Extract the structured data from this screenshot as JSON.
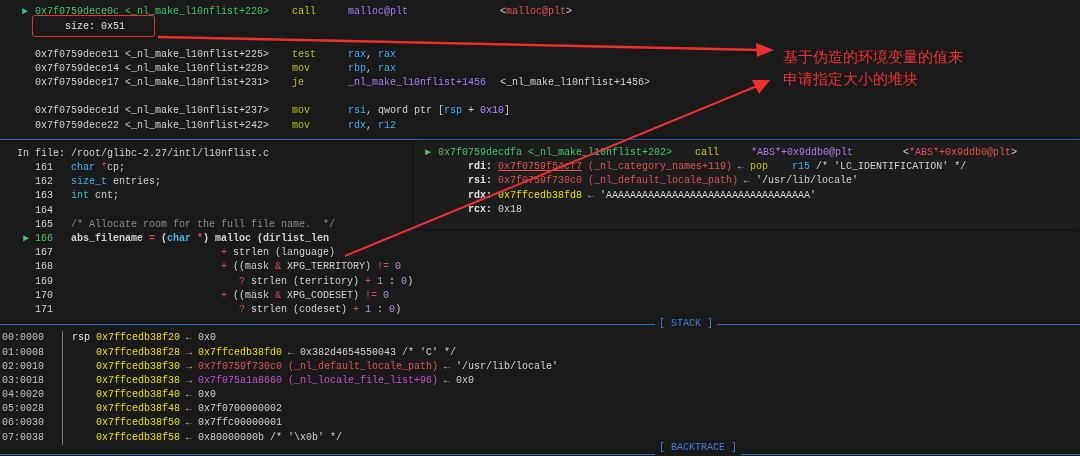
{
  "disassembly": {
    "lines": [
      {
        "kind": "instruction",
        "current": true,
        "marker": "►",
        "address": "0x7f0759dece0c <_nl_make_l10nflist+220>",
        "mnemonic": "call",
        "operands": [
          {
            "text": "malloc@plt",
            "kind": "func"
          }
        ],
        "target": [
          {
            "text": "<",
            "kind": "plain"
          },
          {
            "text": "malloc@plt",
            "kind": "red"
          },
          {
            "text": ">",
            "kind": "plain"
          }
        ]
      },
      {
        "kind": "annotation",
        "text": "size: 0x51",
        "highlighted": true
      },
      {
        "kind": "blank"
      },
      {
        "kind": "instruction",
        "current": false,
        "address": "0x7f0759dece11 <_nl_make_l10nflist+225>",
        "mnemonic": "test",
        "operands": [
          {
            "text": "rax",
            "kind": "reg"
          },
          {
            "text": ", ",
            "kind": "plain"
          },
          {
            "text": "rax",
            "kind": "reg"
          }
        ]
      },
      {
        "kind": "instruction",
        "current": false,
        "address": "0x7f0759dece14 <_nl_make_l10nflist+228>",
        "mnemonic": "mov",
        "operands": [
          {
            "text": "rbp",
            "kind": "reg"
          },
          {
            "text": ", ",
            "kind": "plain"
          },
          {
            "text": "rax",
            "kind": "reg"
          }
        ]
      },
      {
        "kind": "instruction",
        "current": false,
        "address": "0x7f0759dece17 <_nl_make_l10nflist+231>",
        "mnemonic": "je",
        "operands": [
          {
            "text": "_nl_make_l10nflist+1456",
            "kind": "func"
          }
        ],
        "target": [
          {
            "text": "<_nl_make_l10nflist+1456>",
            "kind": "plain"
          }
        ]
      },
      {
        "kind": "blank"
      },
      {
        "kind": "instruction",
        "current": false,
        "address": "0x7f0759dece1d <_nl_make_l10nflist+237>",
        "mnemonic": "mov",
        "operands": [
          {
            "text": "rsi",
            "kind": "reg"
          },
          {
            "text": ", qword ptr [",
            "kind": "plain"
          },
          {
            "text": "rsp",
            "kind": "reg"
          },
          {
            "text": " + ",
            "kind": "plain"
          },
          {
            "text": "0x10",
            "kind": "num"
          },
          {
            "text": "]",
            "kind": "plain"
          }
        ]
      },
      {
        "kind": "instruction",
        "current": false,
        "address": "0x7f0759dece22 <_nl_make_l10nflist+242>",
        "mnemonic": "mov",
        "operands": [
          {
            "text": "rdx",
            "kind": "reg"
          },
          {
            "text": ", ",
            "kind": "plain"
          },
          {
            "text": "r12",
            "kind": "reg"
          }
        ]
      }
    ]
  },
  "source": {
    "file_label": "In file:",
    "path": "/root/glibc-2.27/intl/l10nflist.c",
    "lines": [
      {
        "number": "161",
        "current": false,
        "code": [
          {
            "text": "char",
            "kind": "kw"
          },
          {
            "text": " *",
            "kind": "op"
          },
          {
            "text": "cp;",
            "kind": "plain"
          }
        ]
      },
      {
        "number": "162",
        "current": false,
        "code": [
          {
            "text": "size_t",
            "kind": "kw"
          },
          {
            "text": " entries;",
            "kind": "plain"
          }
        ]
      },
      {
        "number": "163",
        "current": false,
        "code": [
          {
            "text": "int",
            "kind": "kw"
          },
          {
            "text": " cnt;",
            "kind": "plain"
          }
        ]
      },
      {
        "number": "164",
        "current": false
      },
      {
        "number": "165",
        "current": false,
        "code": [
          {
            "text": "/* Allocate room for the full file name.  */",
            "kind": "comment"
          }
        ]
      },
      {
        "number": "166",
        "current": true,
        "marker": "►",
        "code": [
          {
            "text": "abs_filename ",
            "kind": "plain"
          },
          {
            "text": "=",
            "kind": "op"
          },
          {
            "text": " (",
            "kind": "plain"
          },
          {
            "text": "char",
            "kind": "kw"
          },
          {
            "text": " *",
            "kind": "op"
          },
          {
            "text": ") malloc (dirlist_len",
            "kind": "plain"
          }
        ]
      },
      {
        "number": "167",
        "current": false,
        "code": [
          {
            "text": "                         +",
            "kind": "op"
          },
          {
            "text": " strlen (language)",
            "kind": "plain"
          }
        ]
      },
      {
        "number": "168",
        "current": false,
        "code": [
          {
            "text": "                         +",
            "kind": "op"
          },
          {
            "text": " ((mask ",
            "kind": "plain"
          },
          {
            "text": "&",
            "kind": "op"
          },
          {
            "text": " XPG_TERRITORY) ",
            "kind": "plain"
          },
          {
            "text": "!=",
            "kind": "op"
          },
          {
            "text": " 0",
            "kind": "num"
          }
        ]
      },
      {
        "number": "169",
        "current": false,
        "code": [
          {
            "text": "                            ?",
            "kind": "op"
          },
          {
            "text": " strlen (territory) ",
            "kind": "plain"
          },
          {
            "text": "+",
            "kind": "op"
          },
          {
            "text": " 1",
            "kind": "num"
          },
          {
            "text": " : ",
            "kind": "plain"
          },
          {
            "text": "0",
            "kind": "num"
          },
          {
            "text": ")",
            "kind": "plain"
          }
        ]
      },
      {
        "number": "170",
        "current": false,
        "code": [
          {
            "text": "                         +",
            "kind": "op"
          },
          {
            "text": " ((mask ",
            "kind": "plain"
          },
          {
            "text": "&",
            "kind": "op"
          },
          {
            "text": " XPG_CODESET) ",
            "kind": "plain"
          },
          {
            "text": "!=",
            "kind": "op"
          },
          {
            "text": " 0",
            "kind": "num"
          }
        ]
      },
      {
        "number": "171",
        "current": false,
        "code": [
          {
            "text": "                            ?",
            "kind": "op"
          },
          {
            "text": " strlen (codeset) ",
            "kind": "plain"
          },
          {
            "text": "+",
            "kind": "op"
          },
          {
            "text": " 1",
            "kind": "num"
          },
          {
            "text": " : ",
            "kind": "plain"
          },
          {
            "text": "0",
            "kind": "num"
          },
          {
            "text": ")",
            "kind": "plain"
          }
        ]
      }
    ]
  },
  "stack": {
    "title": "[ STACK ]",
    "rows": [
      {
        "offset": "00:0000",
        "register": "rsp",
        "chain": [
          {
            "text": "0x7ffcedb38f20",
            "kind": "yellow"
          },
          {
            "text": " ← 0x0",
            "kind": "plain"
          }
        ]
      },
      {
        "offset": "01:0008",
        "chain": [
          {
            "text": "0x7ffcedb38f28",
            "kind": "yellow"
          },
          {
            "text": " → ",
            "kind": "plain"
          },
          {
            "text": "0x7ffcedb38fd0",
            "kind": "yellow"
          },
          {
            "text": " ← 0x382d4654550043 /* 'C' */",
            "kind": "plain"
          }
        ]
      },
      {
        "offset": "02:0010",
        "chain": [
          {
            "text": "0x7ffcedb38f30",
            "kind": "yellow"
          },
          {
            "text": " → ",
            "kind": "plain"
          },
          {
            "text": "0x7f0759f730c0 (_nl_default_locale_path)",
            "kind": "red"
          },
          {
            "text": " ← '/usr/lib/locale'",
            "kind": "plain"
          }
        ]
      },
      {
        "offset": "03:0018",
        "chain": [
          {
            "text": "0x7ffcedb38f38",
            "kind": "yellow"
          },
          {
            "text": " → ",
            "kind": "plain"
          },
          {
            "text": "0x7f075a1a8660 (_nl_locale_file_list+96)",
            "kind": "magenta"
          },
          {
            "text": " ← 0x0",
            "kind": "plain"
          }
        ]
      },
      {
        "offset": "04:0020",
        "chain": [
          {
            "text": "0x7ffcedb38f40",
            "kind": "yellow"
          },
          {
            "text": " ← 0x0",
            "kind": "plain"
          }
        ]
      },
      {
        "offset": "05:0028",
        "chain": [
          {
            "text": "0x7ffcedb38f48",
            "kind": "yellow"
          },
          {
            "text": " ← 0x7f0700000002",
            "kind": "plain"
          }
        ]
      },
      {
        "offset": "06:0030",
        "chain": [
          {
            "text": "0x7ffcedb38f50",
            "kind": "yellow"
          },
          {
            "text": " ← 0x7ffc00000001",
            "kind": "plain"
          }
        ]
      },
      {
        "offset": "07:0038",
        "chain": [
          {
            "text": "0x7ffcedb38f58",
            "kind": "yellow"
          },
          {
            "text": " ← 0x80000000b /* '\\x0b' */",
            "kind": "plain"
          }
        ]
      }
    ]
  },
  "backtrace": {
    "title": "[ BACKTRACE ]"
  },
  "inset": {
    "lines": [
      {
        "kind": "instruction",
        "current": true,
        "marker": "►",
        "address": "0x7f0759decdfa <_nl_make_l10nflist+202>",
        "mnemonic": "call",
        "operands": [
          {
            "text": "*ABS*+0x9ddb0@plt",
            "kind": "func"
          }
        ],
        "target": [
          {
            "text": "<",
            "kind": "plain"
          },
          {
            "text": "*ABS*+0x9ddb0@plt",
            "kind": "red"
          },
          {
            "text": ">",
            "kind": "plain"
          }
        ]
      },
      {
        "kind": "argument",
        "register": "rdi:",
        "value": [
          {
            "text": "0x7f0759f54cf7",
            "kind": "link"
          },
          {
            "text": " (_nl_category_names+119)",
            "kind": "red"
          },
          {
            "text": " ← ",
            "kind": "plain"
          },
          {
            "text": "pop",
            "kind": "mnem"
          },
          {
            "text": "    r15",
            "kind": "reg"
          },
          {
            "text": " /* 'LC_IDENTIFICATION' */",
            "kind": "plain"
          }
        ]
      },
      {
        "kind": "argument",
        "register": "rsi:",
        "value": [
          {
            "text": "0x7f0759f730c0 (_nl_default_locale_path)",
            "kind": "red"
          },
          {
            "text": " ← '/usr/lib/locale'",
            "kind": "plain"
          }
        ]
      },
      {
        "kind": "argument",
        "register": "rdx:",
        "value": [
          {
            "text": "0x7ffcedb38fd8",
            "kind": "yellow"
          },
          {
            "text": " ← 'AAAAAAAAAAAAAAAAAAAAAAAAAAAAAAAAAA'",
            "kind": "plain"
          }
        ]
      },
      {
        "kind": "argument",
        "register": "rcx:",
        "value": [
          {
            "text": "0x18",
            "kind": "plain"
          }
        ]
      }
    ]
  },
  "annotation": {
    "lines": [
      "基于伪造的环境变量的值来",
      "申请指定大小的堆块"
    ]
  }
}
